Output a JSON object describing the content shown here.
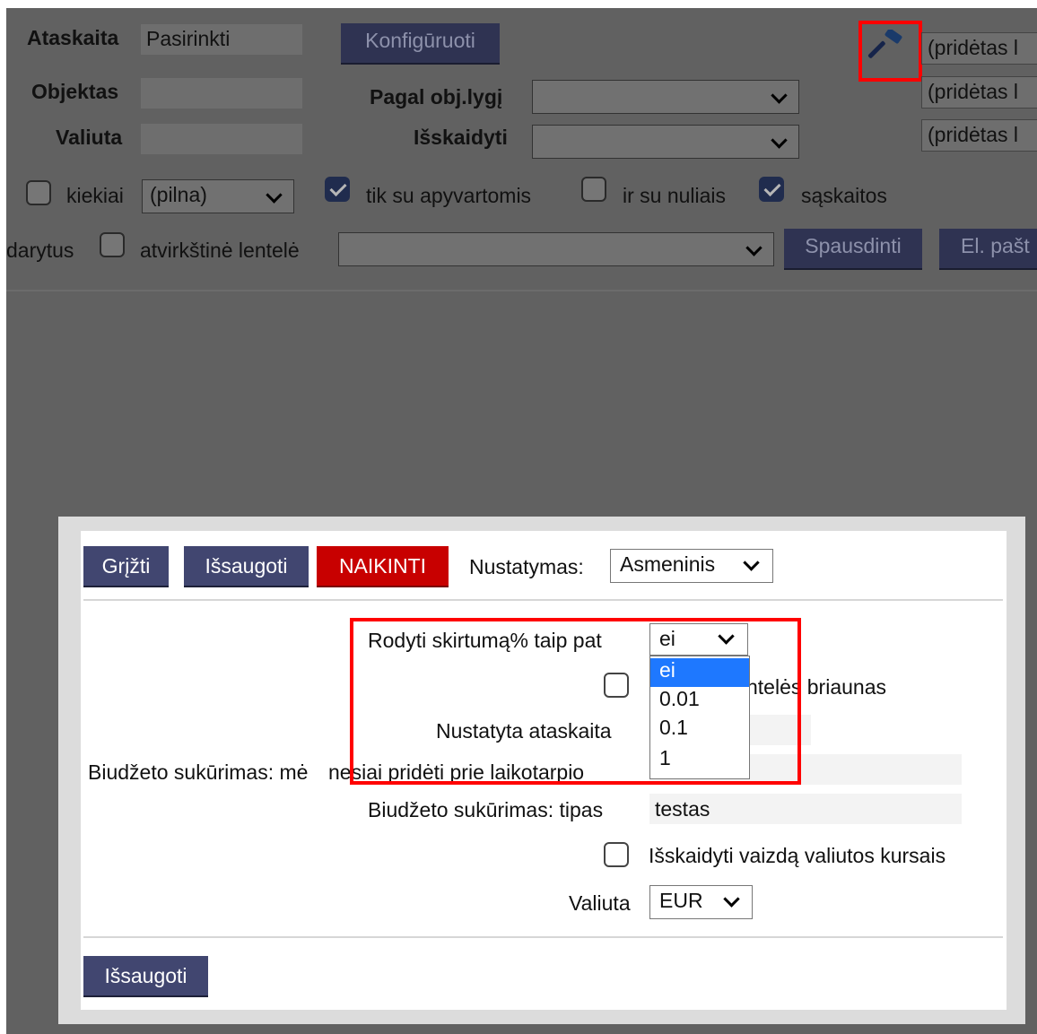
{
  "top": {
    "ataskaita_label": "Ataskaita",
    "ataskaita_value": "Pasirinkti",
    "konfiguruoti_label": "Konfigūruoti",
    "objektas_label": "Objektas",
    "valiuta_label": "Valiuta",
    "pagal_label": "Pagal obj.lygį",
    "isskaidyti_label": "Išskaidyti",
    "pridetas": [
      "(pridėtas l",
      "(pridėtas l",
      "(pridėtas l"
    ],
    "kiekiai_label": "kiekiai",
    "kiekiai_value": "(pilna)",
    "tik_su_apyvartomis": "tik su apyvartomis",
    "ir_su_nuliais": "ir su nuliais",
    "saskaitos": "sąskaitos",
    "darytus": "darytus",
    "atvirkstine": "atvirkštinė lentelė",
    "spausdinti": "Spausdinti",
    "el_pastas": "El. pašt",
    "tool_icon": "hammer-icon"
  },
  "modal": {
    "grizti": "Grįžti",
    "issaugoti_top": "Išsaugoti",
    "naikinti": "NAIKINTI",
    "nustatymas_label": "Nustatymas:",
    "nustatymas_value": "Asmeninis",
    "rodyti_label": "Rodyti skirtumą% taip pat",
    "rodyti_value": "ei",
    "rodyti_options": [
      "ei",
      "0.01",
      "0.1",
      "1"
    ],
    "briaunas_label": "ntelės briaunas",
    "nustatyta_label": "Nustatyta ataskaita",
    "biudz_men_label_a": "Biudžeto sukūrimas: mė",
    "biudz_men_label_b": "nesiai pridėti prie laikotarpio",
    "biudz_tipas_label": "Biudžeto sukūrimas: tipas",
    "biudz_tipas_value": "testas",
    "isskaidyti_kursais": "Išskaidyti vaizdą valiutos kursais",
    "valiuta_label": "Valiuta",
    "valiuta_value": "EUR",
    "issaugoti_bottom": "Išsaugoti"
  },
  "colors": {
    "highlight": "#ff0000",
    "button": "#414670",
    "danger": "#c80000",
    "selected_option": "#1e78ff"
  }
}
